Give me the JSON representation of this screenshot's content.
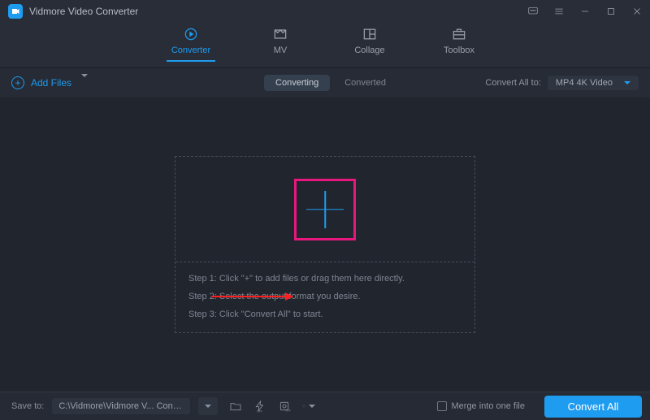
{
  "app": {
    "title": "Vidmore Video Converter"
  },
  "tabs": {
    "converter": "Converter",
    "mv": "MV",
    "collage": "Collage",
    "toolbox": "Toolbox"
  },
  "toolbar": {
    "add_files": "Add Files",
    "converting": "Converting",
    "converted": "Converted",
    "convert_all_to_label": "Convert All to:",
    "format_selected": "MP4 4K Video"
  },
  "dropzone": {
    "step1": "Step 1: Click \"+\" to add files or drag them here directly.",
    "step2": "Step 2: Select the output format you desire.",
    "step3": "Step 3: Click \"Convert All\" to start."
  },
  "footer": {
    "save_to_label": "Save to:",
    "save_path": "C:\\Vidmore\\Vidmore V... Converter\\Converted",
    "merge_label": "Merge into one file",
    "convert_all_btn": "Convert All"
  }
}
